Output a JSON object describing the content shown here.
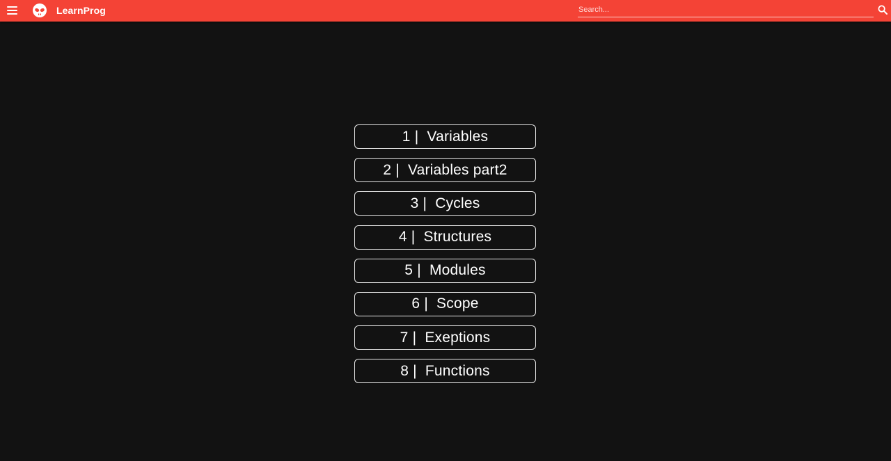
{
  "header": {
    "brand": "LearnProg",
    "search_placeholder": "Search...",
    "bar_color": "#f44336",
    "icons": {
      "menu": "hamburger-menu-icon",
      "logo": "alien-skull-icon",
      "search": "magnifier-search-icon"
    }
  },
  "lessons": [
    {
      "num": "1",
      "title": "Variables"
    },
    {
      "num": "2",
      "title": "Variables part2"
    },
    {
      "num": "3",
      "title": "Cycles"
    },
    {
      "num": "4",
      "title": "Structures"
    },
    {
      "num": "5",
      "title": "Modules"
    },
    {
      "num": "6",
      "title": "Scope"
    },
    {
      "num": "7",
      "title": "Exeptions"
    },
    {
      "num": "8",
      "title": "Functions"
    }
  ],
  "separator": " |  "
}
